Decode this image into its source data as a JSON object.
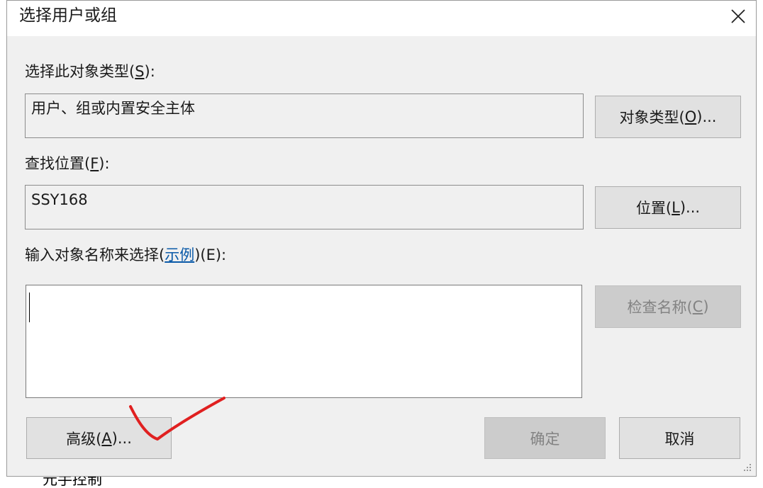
{
  "dialog": {
    "title": "选择用户或组",
    "object_type": {
      "label_prefix": "选择此对象类型(",
      "label_key": "S",
      "label_suffix": "):",
      "value": "用户、组或内置安全主体",
      "button_prefix": "对象类型(",
      "button_key": "O",
      "button_suffix": ")..."
    },
    "location": {
      "label_prefix": "查找位置(",
      "label_key": "F",
      "label_suffix": "):",
      "value": "SSY168",
      "button_prefix": "位置(",
      "button_key": "L",
      "button_suffix": ")..."
    },
    "names": {
      "label_prefix": "输入对象名称来选择(",
      "example_link": "示例",
      "label_suffix": ")(E):",
      "value": "",
      "check_button_prefix": "检查名称(",
      "check_button_key": "C",
      "check_button_suffix": ")"
    },
    "advanced_button": {
      "prefix": "高级(",
      "key": "A",
      "suffix": ")..."
    },
    "ok_button": "确定",
    "cancel_button": "取消"
  },
  "background": {
    "partial_text": "元手控制"
  },
  "annotation_color": "#e02020"
}
